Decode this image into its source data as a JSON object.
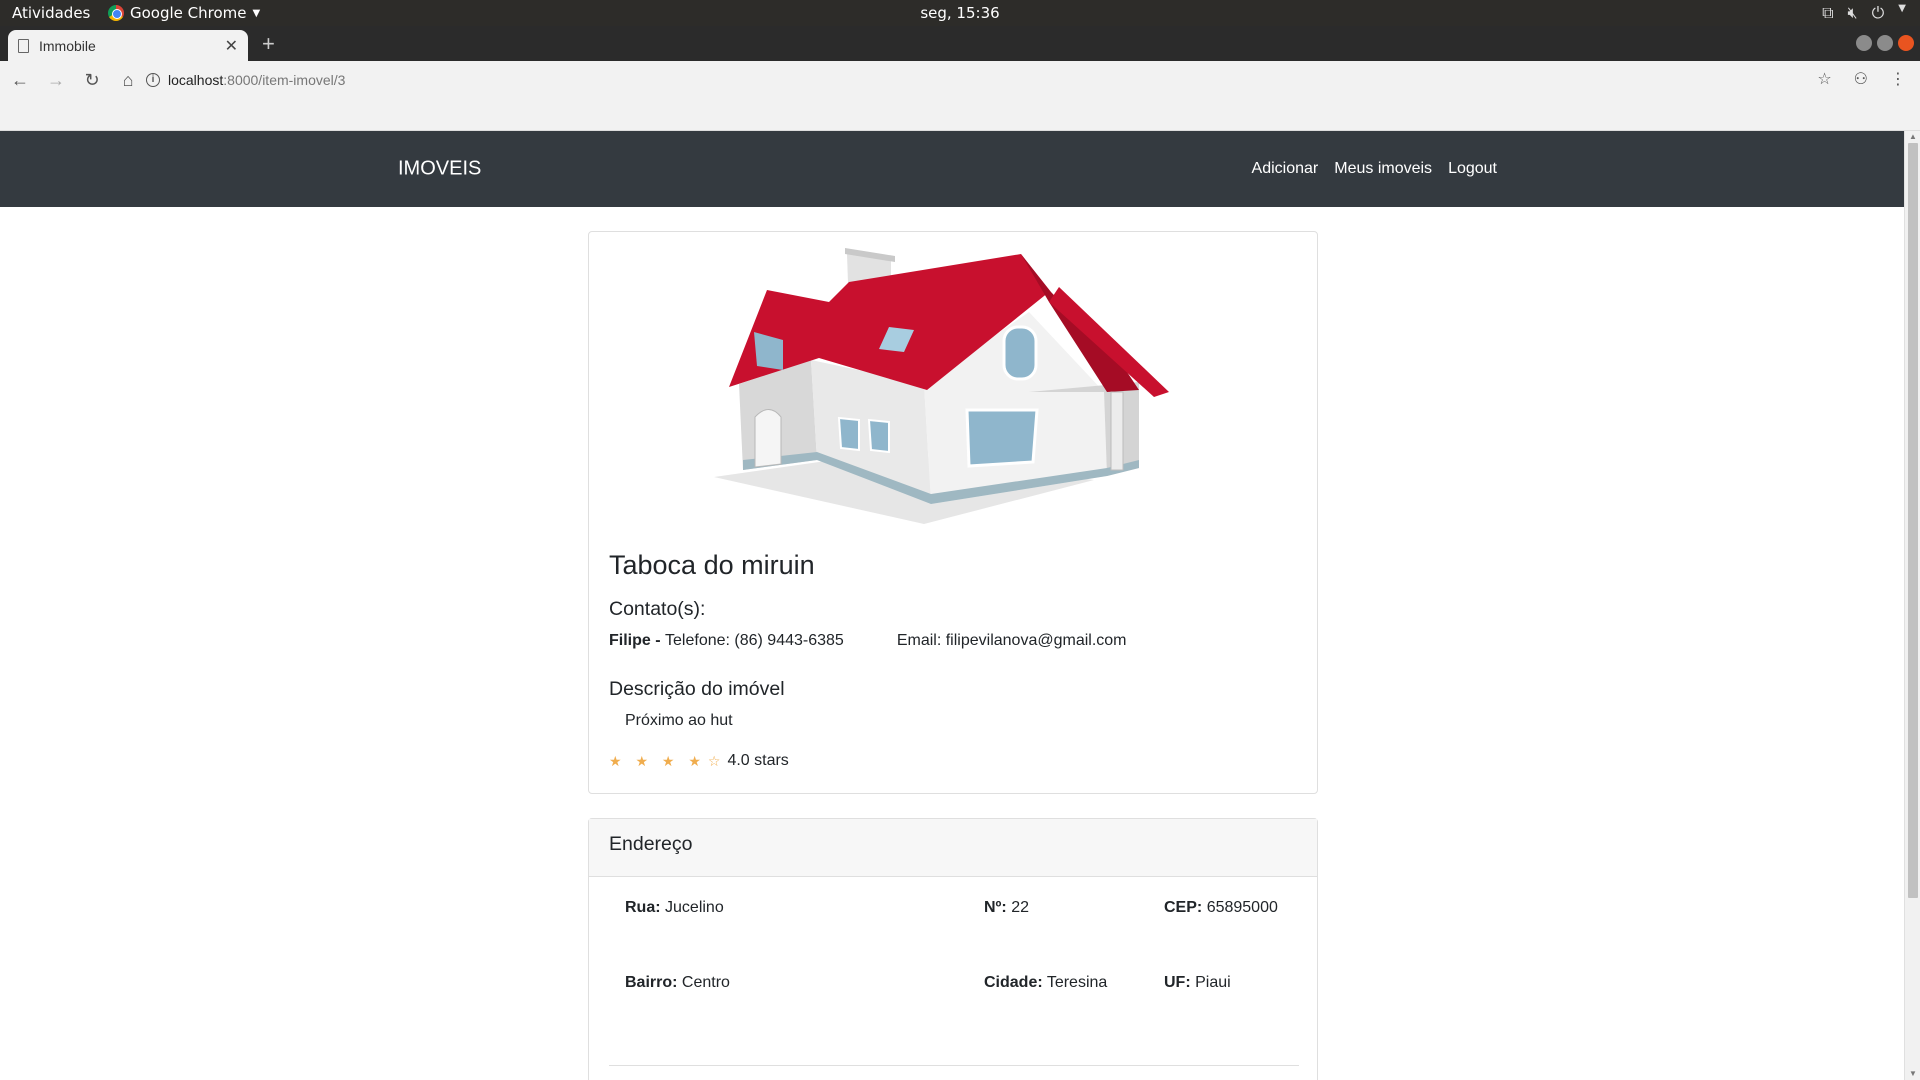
{
  "system_bar": {
    "activities": "Atividades",
    "app_name": "Google Chrome",
    "clock": "seg, 15:36"
  },
  "browser": {
    "tab_title": "Immobile",
    "url_host": "localhost",
    "url_path": ":8000/item-imovel/3"
  },
  "navbar": {
    "brand": "IMOVEIS",
    "links": [
      "Adicionar",
      "Meus imoveis",
      "Logout"
    ]
  },
  "property": {
    "title": "Taboca do miruin",
    "contacts_heading": "Contato(s):",
    "contact": {
      "name": "Filipe -",
      "phone_label": "Telefone:",
      "phone": "(86) 9443-6385",
      "email_label": "Email:",
      "email": "filipevilanova@gmail.com"
    },
    "description_heading": "Descrição do imóvel",
    "description": "Próximo ao hut",
    "rating": {
      "value": 4,
      "max": 5,
      "filled_star": "★ ★ ★ ★",
      "empty_star": "☆",
      "label": "4.0 stars"
    }
  },
  "address": {
    "heading": "Endereço",
    "street_label": "Rua:",
    "street": "Jucelino",
    "number_label": "Nº:",
    "number": "22",
    "cep_label": "CEP:",
    "cep": "65895000",
    "district_label": "Bairro:",
    "district": "Centro",
    "city_label": "Cidade:",
    "city": "Teresina",
    "state_label": "UF:",
    "state": "Piaui"
  },
  "colors": {
    "navbar_bg": "#343a40",
    "star": "#f0ad4e",
    "roof": "#c8102e",
    "btn_danger": "#dc3545",
    "btn_info": "#17a2b8"
  }
}
